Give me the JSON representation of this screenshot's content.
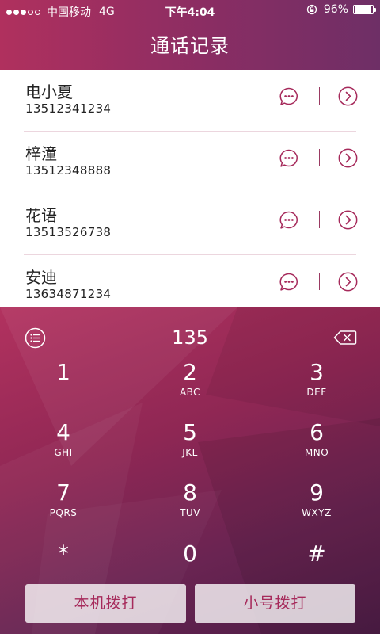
{
  "status_bar": {
    "carrier": "中国移动",
    "network": "4G",
    "time": "下午4:04",
    "battery": "96%",
    "battery_level": 0.96
  },
  "header": {
    "title": "通话记录"
  },
  "contacts": [
    {
      "name": "电小夏",
      "phone": "13512341234"
    },
    {
      "name": "梓潼",
      "phone": "13512348888"
    },
    {
      "name": "花语",
      "phone": "13513526738"
    },
    {
      "name": "安迪",
      "phone": "13634871234"
    }
  ],
  "dialer": {
    "number": "135",
    "keys": [
      {
        "digit": "1",
        "letters": ""
      },
      {
        "digit": "2",
        "letters": "ABC"
      },
      {
        "digit": "3",
        "letters": "DEF"
      },
      {
        "digit": "4",
        "letters": "GHI"
      },
      {
        "digit": "5",
        "letters": "JKL"
      },
      {
        "digit": "6",
        "letters": "MNO"
      },
      {
        "digit": "7",
        "letters": "PQRS"
      },
      {
        "digit": "8",
        "letters": "TUV"
      },
      {
        "digit": "9",
        "letters": "WXYZ"
      },
      {
        "digit": "*",
        "letters": ""
      },
      {
        "digit": "0",
        "letters": ""
      },
      {
        "digit": "#",
        "letters": ""
      }
    ],
    "local_call_label": "本机拨打",
    "trumpet_call_label": "小号拨打"
  },
  "icons": {
    "message": "message-bubble-icon",
    "detail": "chevron-right-circle-icon",
    "contacts": "list-circle-icon",
    "backspace": "backspace-icon"
  },
  "colors": {
    "accent": "#a62a5b",
    "header_start": "#b0305e",
    "header_end": "#6e2f66",
    "dialer_dark": "#4d1d46"
  }
}
